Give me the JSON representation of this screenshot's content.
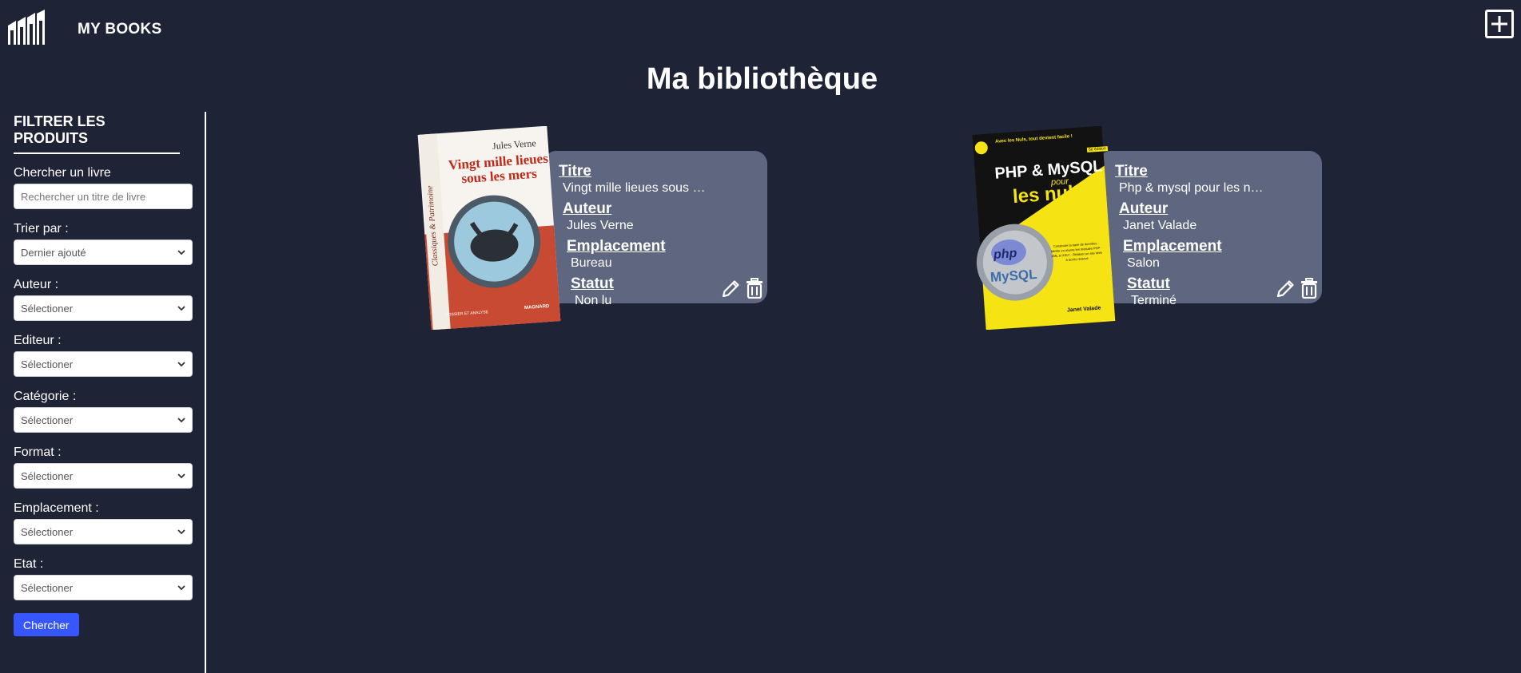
{
  "header": {
    "brand": "MY BOOKS",
    "logo_icon": "books-icon",
    "add_icon": "plus-square-icon"
  },
  "page": {
    "title": "Ma bibliothèque"
  },
  "sidebar": {
    "heading": "FILTRER LES PRODUITS",
    "search_label": "Chercher un livre",
    "search_placeholder": "Rechercher un titre de livre",
    "sort_label": "Trier par :",
    "sort_value": "Dernier ajouté",
    "author_label": "Auteur :",
    "author_value": "Sélectioner",
    "publisher_label": "Editeur :",
    "publisher_value": "Sélectioner",
    "category_label": "Catégorie :",
    "category_value": "Sélectioner",
    "format_label": "Format :",
    "format_value": "Sélectioner",
    "location_label": "Emplacement :",
    "location_value": "Sélectioner",
    "state_label": "Etat :",
    "state_value": "Sélectioner",
    "search_button": "Chercher"
  },
  "labels": {
    "title": "Titre",
    "author": "Auteur",
    "location": "Emplacement",
    "status": "Statut"
  },
  "books": [
    {
      "title": "Vingt mille lieues sous …",
      "author": "Jules Verne",
      "location": "Bureau",
      "status": "Non lu",
      "cover": {
        "author": "Jules Verne",
        "title_line1": "Vingt mille lieues",
        "title_line2": "sous les mers",
        "series": "Classiques & Patrimoine",
        "publisher": "MAGNARD",
        "edition_note": "DOSSIER ET ANALYSE"
      }
    },
    {
      "title": "Php & mysql pour les n…",
      "author": "Janet Valade",
      "location": "Salon",
      "status": "Terminé",
      "cover": {
        "banner": "Avec les Nuls, tout devient facile !",
        "heading": "PHP & MySQL",
        "pour": "pour",
        "nuls": "les nuls",
        "edition": "6e édition",
        "author": "Janet Valade",
        "logo_top": "php",
        "logo_bottom": "MySQL",
        "bullets": "Construire la base de données · Mettre en œuvre les modules PHP · XML et XSLT · Réaliser un site Web à accès réservé"
      }
    }
  ],
  "colors": {
    "background": "#1f2336",
    "card": "#5f667f",
    "button": "#3656ff"
  }
}
